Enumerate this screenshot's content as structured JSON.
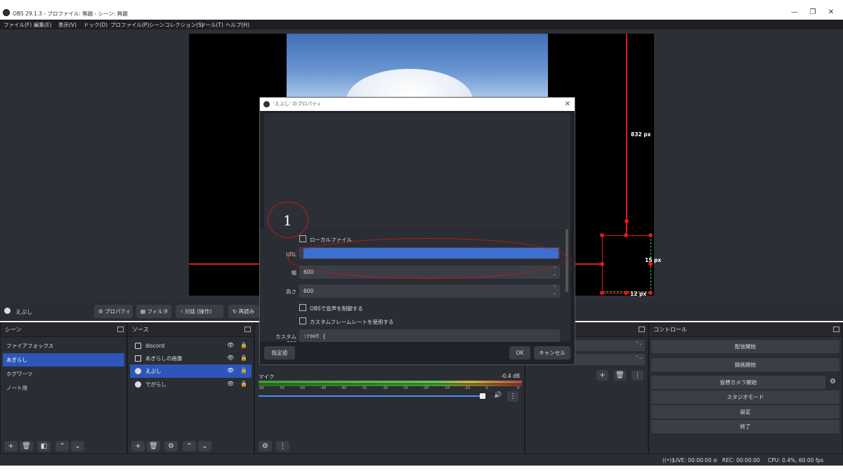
{
  "window": {
    "title": "OBS 29.1.3 - プロファイル: 無題 - シーン: 無題",
    "min": "—",
    "max": "❐",
    "close": "✕"
  },
  "menu": [
    "ファイル(F)",
    "編集(E)",
    "表示(V)",
    "ドック(D)",
    "プロファイル(P)",
    "シーンコレクション(S)",
    "ツール(T)",
    "ヘルプ(H)"
  ],
  "canvas": {
    "height_label": "832 px",
    "right_label": "15 px",
    "bottom_label": "12 px"
  },
  "source_toolbar": {
    "name": "えぶし",
    "properties": "プロパティ",
    "filters": "フィルタ",
    "interact": "対話 (操作)",
    "reload": "再読み"
  },
  "scenes": {
    "title": "シーン",
    "items": [
      "ファイアフォックス",
      "あぎらし",
      "ホグワーツ",
      "ノート用"
    ],
    "selected": 1
  },
  "sources": {
    "title": "ソース",
    "items": [
      "discord",
      "あぎらしの画像",
      "えぶし",
      "でがらし"
    ],
    "selected": 2
  },
  "mixer": {
    "name": "マイク",
    "db": "-0.4 dB",
    "ticks": [
      "-60",
      "-55",
      "-50",
      "-45",
      "-40",
      "-35",
      "-30",
      "-25",
      "-20",
      "-15",
      "-10",
      "-5",
      "0"
    ]
  },
  "controls": {
    "title": "コントロール",
    "buttons": [
      "配信開始",
      "録画開始",
      "仮想カメラ開始",
      "スタジオモード",
      "設定",
      "終了"
    ]
  },
  "status": {
    "live": "LIVE: 00:00:00",
    "rec": "REC: 00:00:00",
    "cpu": "CPU: 0.4%, 60.00 fps"
  },
  "dialog": {
    "title": "'えぶし' のプロパティ",
    "local_file": "ローカルファイル",
    "url_label": "URL",
    "url_value": "",
    "width_label": "幅",
    "width_value": "600",
    "height_label": "高さ",
    "height_value": "600",
    "obs_audio": "OBSで音声を制御する",
    "custom_fps": "カスタムフレームレートを使用する",
    "css_label": "カスタム CSS",
    "css_value": ":root {",
    "defaults": "既定値",
    "ok": "OK",
    "cancel": "キャンセル"
  },
  "annotation": {
    "number": "1",
    "color": "#c2191b"
  }
}
